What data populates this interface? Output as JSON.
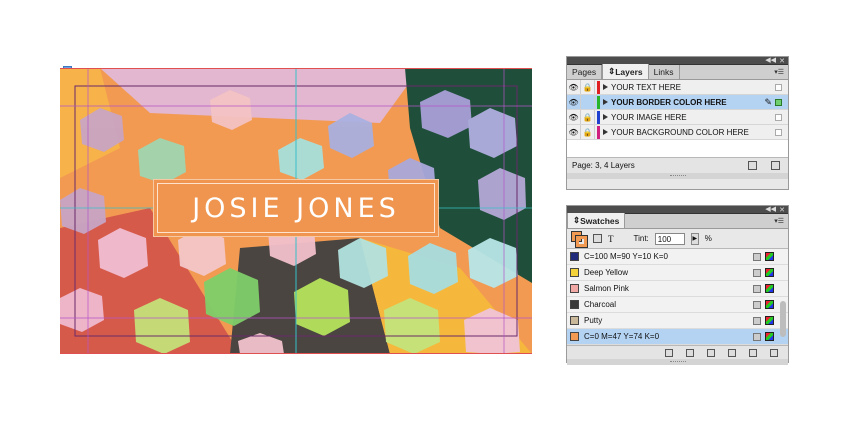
{
  "canvas": {
    "card_name": "JOSIE JONES",
    "colors": {
      "background": "#f29a52",
      "name_box": "#f0954f",
      "pink": "#e2b7cf",
      "green": "#1f4f3a",
      "red": "#d65a4a",
      "charcoal": "#4a4540"
    },
    "shape_icons": "hexagonal-paper-shapes"
  },
  "layers_panel": {
    "tabs": [
      "Pages",
      "Layers",
      "Links"
    ],
    "active_tab": "Layers",
    "layers": [
      {
        "name": "YOUR TEXT HERE",
        "color": "#e02020",
        "selected": false
      },
      {
        "name": "YOUR BORDER COLOR HERE",
        "color": "#28b428",
        "selected": true
      },
      {
        "name": "YOUR IMAGE HERE",
        "color": "#2040d0",
        "selected": false
      },
      {
        "name": "YOUR BACKGROUND COLOR HERE",
        "color": "#d02080",
        "selected": false
      }
    ],
    "footer_text": "Page: 3, 4 Layers"
  },
  "swatches_panel": {
    "title": "Swatches",
    "tint_label": "Tint:",
    "tint_value": "100",
    "tint_unit": "%",
    "swatches": [
      {
        "name": "C=100 M=90 Y=10 K=0",
        "color": "#1f2a7a",
        "selected": false
      },
      {
        "name": "Deep Yellow",
        "color": "#f3d23a",
        "selected": false
      },
      {
        "name": "Salmon Pink",
        "color": "#f2a9a6",
        "selected": false
      },
      {
        "name": "Charcoal",
        "color": "#3a3a3a",
        "selected": false
      },
      {
        "name": "Putty",
        "color": "#c9b99a",
        "selected": false
      },
      {
        "name": "C=0 M=47 Y=74 K=0",
        "color": "#f29a52",
        "selected": true
      }
    ]
  }
}
